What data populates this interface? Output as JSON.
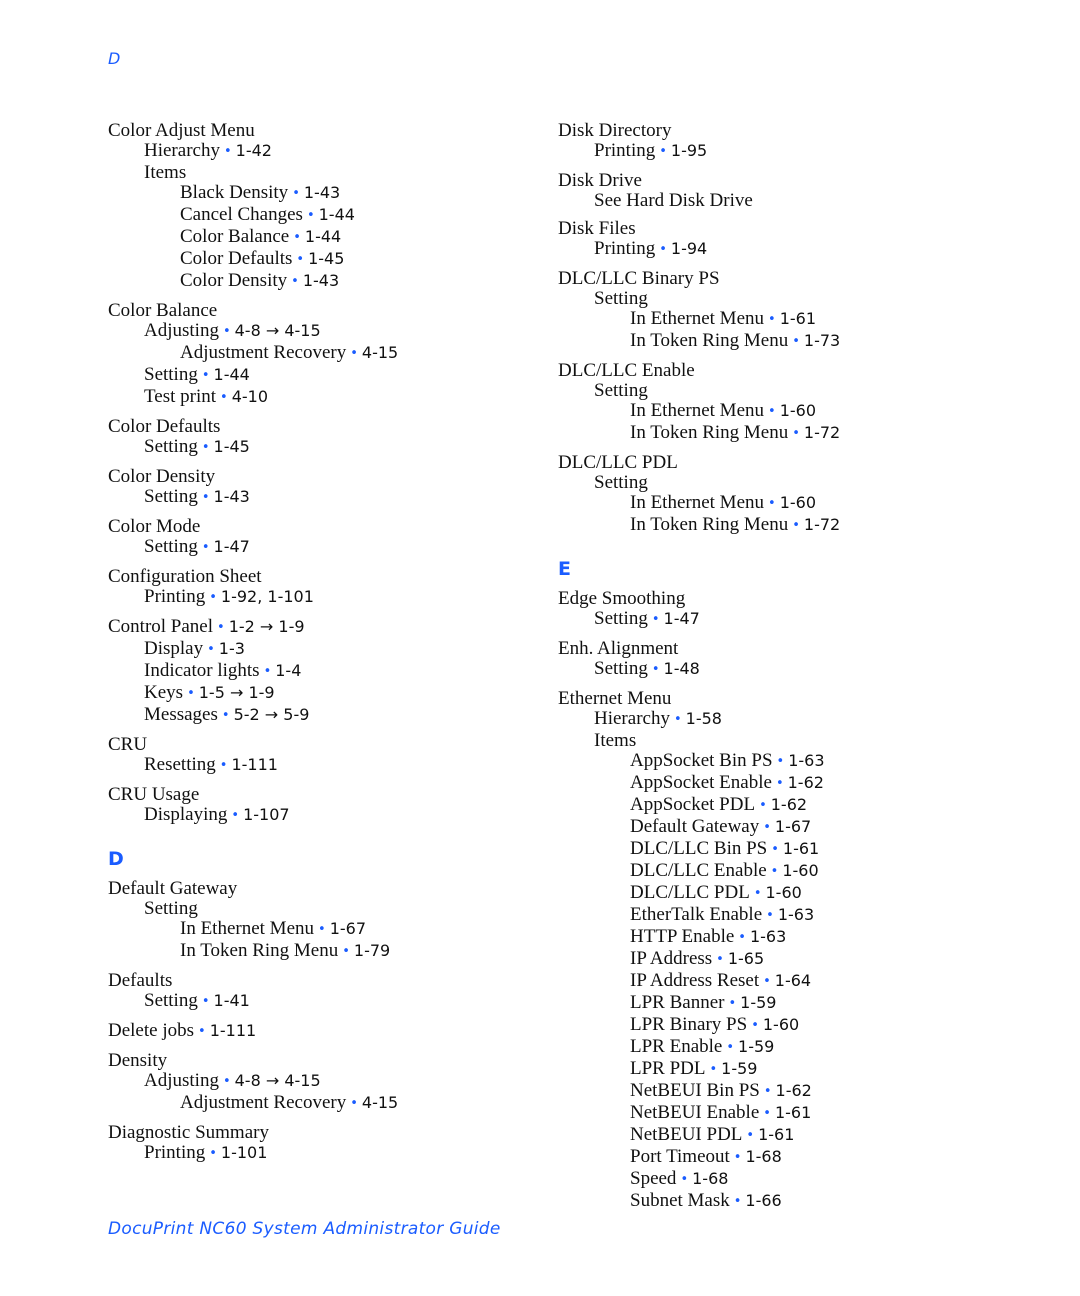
{
  "running_head": "D",
  "footer": "DocuPrint NC60 System Administrator Guide",
  "bullet": "•",
  "columns": [
    [
      {
        "type": "entry",
        "lines": [
          {
            "level": 1,
            "term": "Color Adjust Menu",
            "pages": ""
          },
          {
            "level": 2,
            "term": "Hierarchy",
            "pages": "1-42"
          },
          {
            "level": 2,
            "term": "Items",
            "pages": ""
          },
          {
            "level": 3,
            "term": "Black Density",
            "pages": "1-43"
          },
          {
            "level": 3,
            "term": "Cancel Changes",
            "pages": "1-44"
          },
          {
            "level": 3,
            "term": "Color Balance",
            "pages": "1-44"
          },
          {
            "level": 3,
            "term": "Color Defaults",
            "pages": "1-45"
          },
          {
            "level": 3,
            "term": "Color Density",
            "pages": "1-43"
          }
        ]
      },
      {
        "type": "entry",
        "lines": [
          {
            "level": 1,
            "term": "Color Balance",
            "pages": ""
          },
          {
            "level": 2,
            "term": "Adjusting",
            "pages": "4-8 → 4-15"
          },
          {
            "level": 3,
            "term": "Adjustment Recovery",
            "pages": "4-15"
          },
          {
            "level": 2,
            "term": "Setting",
            "pages": "1-44"
          },
          {
            "level": 2,
            "term": "Test print",
            "pages": "4-10"
          }
        ]
      },
      {
        "type": "entry",
        "lines": [
          {
            "level": 1,
            "term": "Color Defaults",
            "pages": ""
          },
          {
            "level": 2,
            "term": "Setting",
            "pages": "1-45"
          }
        ]
      },
      {
        "type": "entry",
        "lines": [
          {
            "level": 1,
            "term": "Color Density",
            "pages": ""
          },
          {
            "level": 2,
            "term": "Setting",
            "pages": "1-43"
          }
        ]
      },
      {
        "type": "entry",
        "lines": [
          {
            "level": 1,
            "term": "Color Mode",
            "pages": ""
          },
          {
            "level": 2,
            "term": "Setting",
            "pages": "1-47"
          }
        ]
      },
      {
        "type": "entry",
        "lines": [
          {
            "level": 1,
            "term": "Configuration Sheet",
            "pages": ""
          },
          {
            "level": 2,
            "term": "Printing",
            "pages": "1-92, 1-101"
          }
        ]
      },
      {
        "type": "entry",
        "lines": [
          {
            "level": 1,
            "term": "Control Panel",
            "pages": "1-2 → 1-9"
          },
          {
            "level": 2,
            "term": "Display",
            "pages": "1-3"
          },
          {
            "level": 2,
            "term": "Indicator lights",
            "pages": "1-4"
          },
          {
            "level": 2,
            "term": "Keys",
            "pages": "1-5 → 1-9"
          },
          {
            "level": 2,
            "term": "Messages",
            "pages": "5-2 → 5-9"
          }
        ]
      },
      {
        "type": "entry",
        "lines": [
          {
            "level": 1,
            "term": "CRU",
            "pages": ""
          },
          {
            "level": 2,
            "term": "Resetting",
            "pages": "1-111"
          }
        ]
      },
      {
        "type": "entry",
        "lines": [
          {
            "level": 1,
            "term": "CRU Usage",
            "pages": ""
          },
          {
            "level": 2,
            "term": "Displaying",
            "pages": "1-107"
          }
        ]
      },
      {
        "type": "letter",
        "label": "D"
      },
      {
        "type": "entry",
        "lines": [
          {
            "level": 1,
            "term": "Default Gateway",
            "pages": ""
          },
          {
            "level": 2,
            "term": "Setting",
            "pages": ""
          },
          {
            "level": 3,
            "term": "In Ethernet Menu",
            "pages": "1-67"
          },
          {
            "level": 3,
            "term": "In Token Ring Menu",
            "pages": "1-79"
          }
        ]
      },
      {
        "type": "entry",
        "lines": [
          {
            "level": 1,
            "term": "Defaults",
            "pages": ""
          },
          {
            "level": 2,
            "term": "Setting",
            "pages": "1-41"
          }
        ]
      },
      {
        "type": "entry",
        "lines": [
          {
            "level": 1,
            "term": "Delete jobs",
            "pages": "1-111"
          }
        ]
      },
      {
        "type": "entry",
        "lines": [
          {
            "level": 1,
            "term": "Density",
            "pages": ""
          },
          {
            "level": 2,
            "term": "Adjusting",
            "pages": "4-8 → 4-15"
          },
          {
            "level": 3,
            "term": "Adjustment Recovery",
            "pages": "4-15"
          }
        ]
      },
      {
        "type": "entry",
        "lines": [
          {
            "level": 1,
            "term": "Diagnostic Summary",
            "pages": ""
          },
          {
            "level": 2,
            "term": "Printing",
            "pages": "1-101"
          }
        ]
      }
    ],
    [
      {
        "type": "entry",
        "lines": [
          {
            "level": 1,
            "term": "Disk Directory",
            "pages": ""
          },
          {
            "level": 2,
            "term": "Printing",
            "pages": "1-95"
          }
        ]
      },
      {
        "type": "entry",
        "lines": [
          {
            "level": 1,
            "term": "Disk Drive",
            "pages": ""
          },
          {
            "level": 2,
            "term": "See Hard Disk Drive",
            "pages": ""
          }
        ]
      },
      {
        "type": "entry",
        "lines": [
          {
            "level": 1,
            "term": "Disk Files",
            "pages": ""
          },
          {
            "level": 2,
            "term": "Printing",
            "pages": "1-94"
          }
        ]
      },
      {
        "type": "entry",
        "lines": [
          {
            "level": 1,
            "term": "DLC/LLC Binary PS",
            "pages": ""
          },
          {
            "level": 2,
            "term": "Setting",
            "pages": ""
          },
          {
            "level": 3,
            "term": "In Ethernet Menu",
            "pages": "1-61"
          },
          {
            "level": 3,
            "term": "In Token Ring Menu",
            "pages": "1-73"
          }
        ]
      },
      {
        "type": "entry",
        "lines": [
          {
            "level": 1,
            "term": "DLC/LLC Enable",
            "pages": ""
          },
          {
            "level": 2,
            "term": "Setting",
            "pages": ""
          },
          {
            "level": 3,
            "term": "In Ethernet Menu",
            "pages": "1-60"
          },
          {
            "level": 3,
            "term": "In Token Ring Menu",
            "pages": "1-72"
          }
        ]
      },
      {
        "type": "entry",
        "lines": [
          {
            "level": 1,
            "term": "DLC/LLC PDL",
            "pages": ""
          },
          {
            "level": 2,
            "term": "Setting",
            "pages": ""
          },
          {
            "level": 3,
            "term": "In Ethernet Menu",
            "pages": "1-60"
          },
          {
            "level": 3,
            "term": "In Token Ring Menu",
            "pages": "1-72"
          }
        ]
      },
      {
        "type": "letter",
        "label": "E"
      },
      {
        "type": "entry",
        "lines": [
          {
            "level": 1,
            "term": "Edge Smoothing",
            "pages": ""
          },
          {
            "level": 2,
            "term": "Setting",
            "pages": "1-47"
          }
        ]
      },
      {
        "type": "entry",
        "lines": [
          {
            "level": 1,
            "term": "Enh. Alignment",
            "pages": ""
          },
          {
            "level": 2,
            "term": "Setting",
            "pages": "1-48"
          }
        ]
      },
      {
        "type": "entry",
        "lines": [
          {
            "level": 1,
            "term": "Ethernet Menu",
            "pages": ""
          },
          {
            "level": 2,
            "term": "Hierarchy",
            "pages": "1-58"
          },
          {
            "level": 2,
            "term": "Items",
            "pages": ""
          },
          {
            "level": 3,
            "term": "AppSocket Bin PS",
            "pages": "1-63"
          },
          {
            "level": 3,
            "term": "AppSocket Enable",
            "pages": "1-62"
          },
          {
            "level": 3,
            "term": "AppSocket PDL",
            "pages": "1-62"
          },
          {
            "level": 3,
            "term": "Default Gateway",
            "pages": "1-67"
          },
          {
            "level": 3,
            "term": "DLC/LLC Bin PS",
            "pages": "1-61"
          },
          {
            "level": 3,
            "term": "DLC/LLC Enable",
            "pages": "1-60"
          },
          {
            "level": 3,
            "term": "DLC/LLC PDL",
            "pages": "1-60"
          },
          {
            "level": 3,
            "term": "EtherTalk Enable",
            "pages": "1-63"
          },
          {
            "level": 3,
            "term": "HTTP Enable",
            "pages": "1-63"
          },
          {
            "level": 3,
            "term": "IP Address",
            "pages": "1-65"
          },
          {
            "level": 3,
            "term": "IP Address Reset",
            "pages": "1-64"
          },
          {
            "level": 3,
            "term": "LPR Banner",
            "pages": "1-59"
          },
          {
            "level": 3,
            "term": "LPR Binary PS",
            "pages": "1-60"
          },
          {
            "level": 3,
            "term": "LPR Enable",
            "pages": "1-59"
          },
          {
            "level": 3,
            "term": "LPR PDL",
            "pages": "1-59"
          },
          {
            "level": 3,
            "term": "NetBEUI Bin PS",
            "pages": "1-62"
          },
          {
            "level": 3,
            "term": "NetBEUI Enable",
            "pages": "1-61"
          },
          {
            "level": 3,
            "term": "NetBEUI PDL",
            "pages": "1-61"
          },
          {
            "level": 3,
            "term": "Port Timeout",
            "pages": "1-68"
          },
          {
            "level": 3,
            "term": "Speed",
            "pages": "1-68"
          },
          {
            "level": 3,
            "term": "Subnet Mask",
            "pages": "1-66"
          }
        ]
      }
    ]
  ]
}
